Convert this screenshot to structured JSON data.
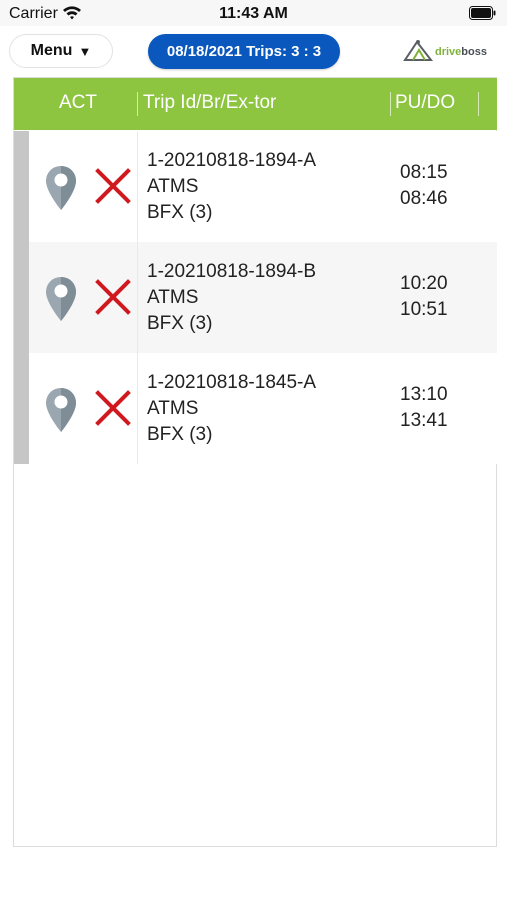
{
  "status_bar": {
    "carrier": "Carrier",
    "time": "11:43 AM"
  },
  "header": {
    "menu_label": "Menu",
    "caret": "▼",
    "trips_summary": "08/18/2021 Trips: 3 : 3",
    "logo_text_a": "drive",
    "logo_text_b": "boss"
  },
  "table": {
    "columns": [
      "ACT",
      "Trip Id/Br/Ex-tor",
      "PU/DO"
    ],
    "rows": [
      {
        "trip_id": "1-20210818-1894-A",
        "broker": "ATMS",
        "executor": "BFX (3)",
        "pu": "08:15",
        "do": "08:46"
      },
      {
        "trip_id": "1-20210818-1894-B",
        "broker": "ATMS",
        "executor": "BFX (3)",
        "pu": "10:20",
        "do": "10:51"
      },
      {
        "trip_id": "1-20210818-1845-A",
        "broker": "ATMS",
        "executor": "BFX (3)",
        "pu": "13:10",
        "do": "13:41"
      }
    ]
  },
  "colors": {
    "header_green": "#8dc440",
    "pill_blue": "#0a58bd",
    "cancel_red": "#d0191f",
    "pin_gray": "#9aa7b0",
    "row_alt": "#f6f6f6"
  },
  "icons": [
    "wifi-icon",
    "battery-icon",
    "map-pin-icon",
    "cancel-x-icon"
  ]
}
